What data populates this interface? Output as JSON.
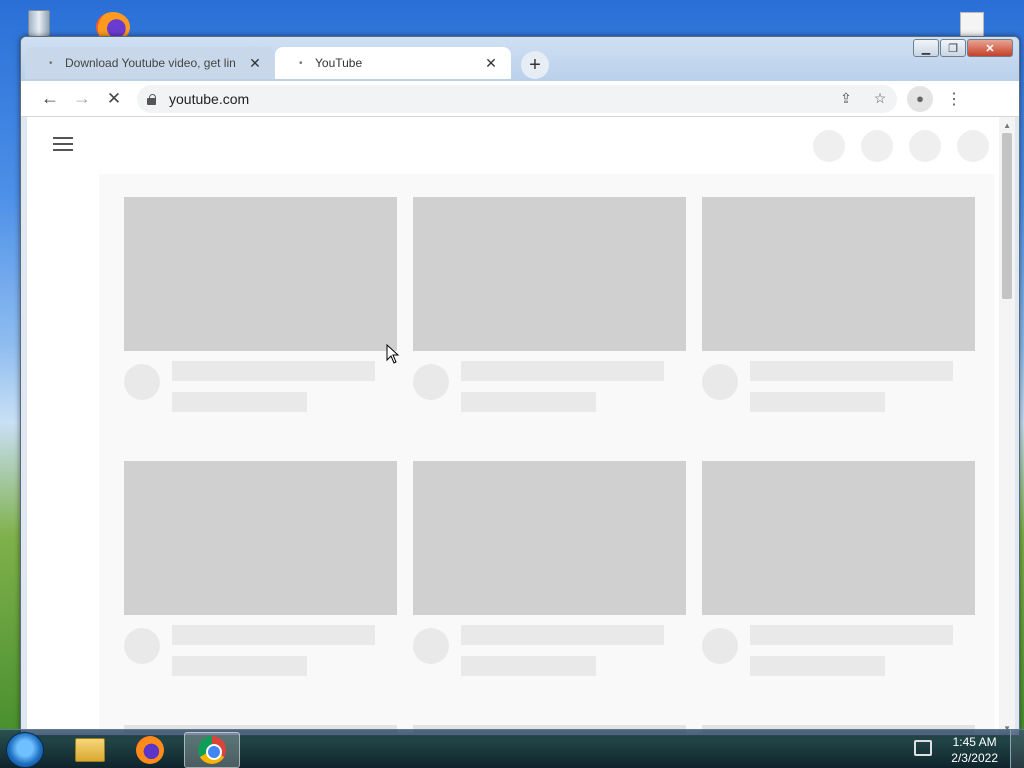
{
  "browser": {
    "tabs": [
      {
        "label": "Download Youtube video, get lin",
        "favicon": "loading-dot-icon"
      },
      {
        "label": "YouTube",
        "favicon": "loading-dot-icon"
      }
    ],
    "address": "youtube.com"
  },
  "taskbar": {
    "time": "1:45 AM",
    "date": "2/3/2022"
  },
  "colors": {
    "skeleton_thumb": "#d0d0d0",
    "skeleton_line": "#e9e9e9",
    "page_bg": "#f9f9f9"
  }
}
